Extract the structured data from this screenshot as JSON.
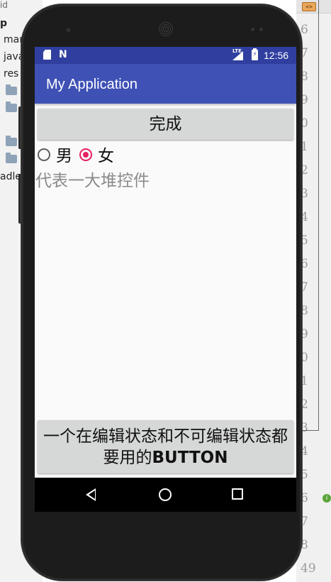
{
  "ide": {
    "tree_items": [
      "id",
      "p",
      "mar",
      "java",
      "res",
      "adle"
    ],
    "gutter_tab_icon": "<>",
    "line_numbers": [
      "6",
      "7",
      "8",
      "9",
      "0",
      "1",
      "2",
      "3",
      "4",
      "5",
      "6",
      "7",
      "8",
      "9",
      "0",
      "1",
      "2",
      "3",
      "4",
      "5",
      "6",
      "7",
      "8",
      "49"
    ]
  },
  "app": {
    "status_time": "12:56",
    "status_lte": "LTE",
    "status_n_icon": "N",
    "title": "My Application",
    "done_button": "完成",
    "radio_male": "男",
    "radio_female": "女",
    "radio_selected": "女",
    "placeholder_text": "代表一大堆控件",
    "bottom_button": "一个在编辑状态和不可编辑状态都要用的BUTTON"
  },
  "colors": {
    "status_bar": "#303f9f",
    "app_bar": "#3f51b5",
    "accent": "#e91e63",
    "button": "#d6d7d7"
  },
  "icons": [
    "sd-card-icon",
    "n-notification-icon",
    "lte-signal-icon",
    "battery-charging-icon",
    "back-icon",
    "home-icon",
    "recents-icon"
  ]
}
